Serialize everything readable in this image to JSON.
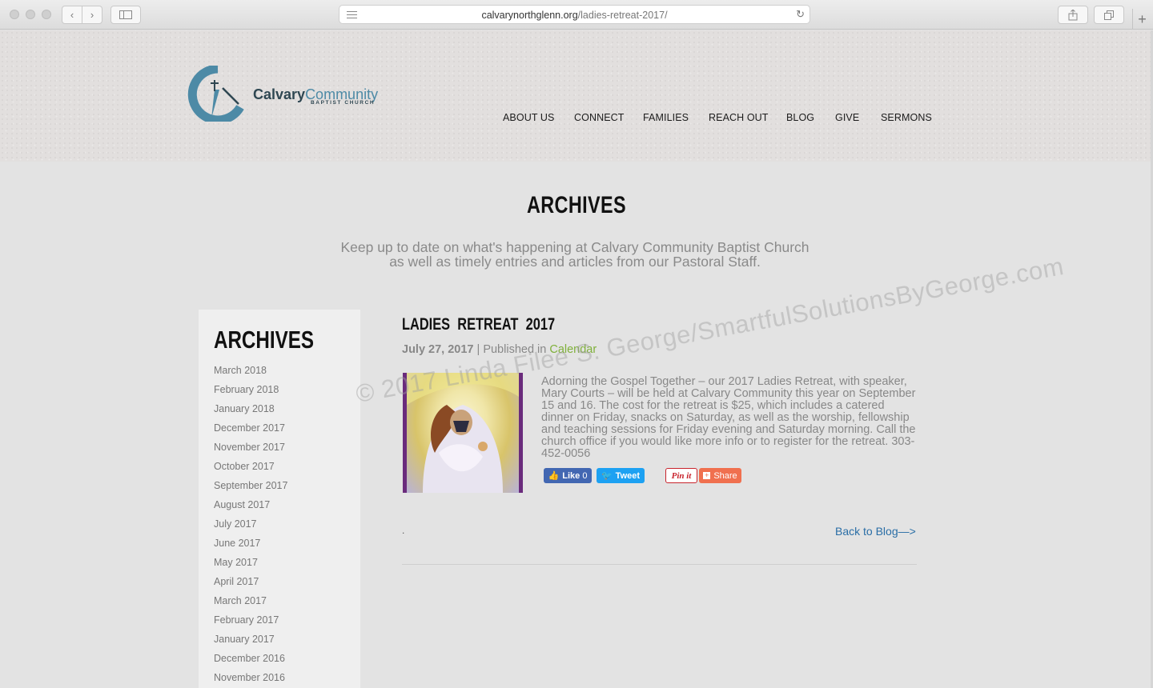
{
  "browser": {
    "url_domain": "calvarynorthglenn.org",
    "url_path": "/ladies-retreat-2017/"
  },
  "logo": {
    "name_bold": "Calvary",
    "name_light": "Community",
    "sub": "BAPTIST CHURCH"
  },
  "nav": {
    "about": "ABOUT US",
    "connect": "CONNECT",
    "families": "FAMILIES",
    "reach_out": "REACH OUT",
    "blog": "BLOG",
    "give": "GIVE",
    "sermons": "SERMONS"
  },
  "page": {
    "title": "ARCHIVES",
    "intro": "Keep up to date on what's happening at Calvary Community Baptist Church as well as timely entries and articles from our Pastoral Staff."
  },
  "sidebar": {
    "title": "ARCHIVES",
    "items": [
      "March 2018",
      "February 2018",
      "January 2018",
      "December 2017",
      "November 2017",
      "October 2017",
      "September 2017",
      "August 2017",
      "July 2017",
      "June 2017",
      "May 2017",
      "April 2017",
      "March 2017",
      "February 2017",
      "January 2017",
      "December 2016",
      "November 2016"
    ]
  },
  "post": {
    "title": "LADIES RETREAT 2017",
    "date": "July 27, 2017",
    "published_in": " | Published in ",
    "category": "Calendar",
    "body": "Adorning the Gospel Together – our 2017 Ladies Retreat, with speaker, Mary Courts – will be held at Calvary Community this year on September 15 and 16. The cost for the retreat is $25, which includes a catered dinner on Friday, snacks on Saturday, as well as the worship, fellowship and teaching sessions for Friday evening and Saturday morning. Call the church office if you would like more info or to register for the retreat. 303-452-0056",
    "like_label": "Like",
    "like_count": "0",
    "tweet_label": "Tweet",
    "pin_label": "Pin it",
    "share_label": "Share",
    "dot": ".",
    "back_link": "Back to Blog—>"
  },
  "watermark": "© 2017 Linda Filee S. George/SmartfulSolutionsByGeorge.com",
  "colors": {
    "logo_blue": "#4d8aa6",
    "category_green": "#7fb03a",
    "link_blue": "#2a6ea6",
    "facebook_blue": "#4267b2",
    "twitter_blue": "#1da1f2",
    "share_orange": "#f0704f",
    "image_frame_purple": "#6a2b7c"
  }
}
